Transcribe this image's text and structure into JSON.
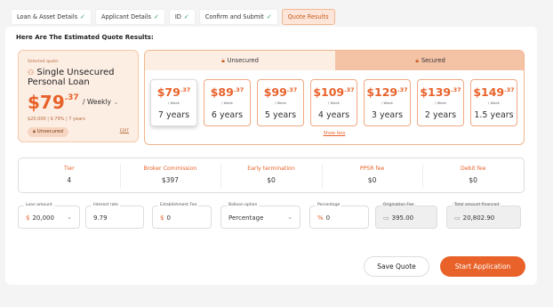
{
  "tabs": [
    {
      "label": "Loan & Asset Details",
      "done": "✓"
    },
    {
      "label": "Applicant Details",
      "done": "✓"
    },
    {
      "label": "ID",
      "done": "✓"
    },
    {
      "label": "Confirm and Submit",
      "done": "✓"
    },
    {
      "label": "Quote Results",
      "done": ""
    }
  ],
  "heading": "Here Are The Estimated Quote Results:",
  "selected": {
    "label": "Selected quote:",
    "name": "Single Unsecured Personal Loan",
    "price_whole": "$79",
    "price_cents": ".37",
    "frequency": "/ Weekly",
    "meta": "$20,000 | 9.79% | 7 years",
    "badge": "Unsecured",
    "edit": "EDIT"
  },
  "loan_tabs": {
    "unsecured": "Unsecured",
    "secured": "Secured"
  },
  "quotes": [
    {
      "whole": "$79",
      "cents": ".37",
      "per": "/ Week",
      "years": "7 years"
    },
    {
      "whole": "$89",
      "cents": ".37",
      "per": "/ Week",
      "years": "6 years"
    },
    {
      "whole": "$99",
      "cents": ".37",
      "per": "/ Week",
      "years": "5 years"
    },
    {
      "whole": "$109",
      "cents": ".37",
      "per": "/ Week",
      "years": "4 years"
    },
    {
      "whole": "$129",
      "cents": ".37",
      "per": "/ Week",
      "years": "3 years"
    },
    {
      "whole": "$139",
      "cents": ".37",
      "per": "/ Week",
      "years": "2 years"
    },
    {
      "whole": "$149",
      "cents": ".37",
      "per": "/ Week",
      "years": "1.5 years"
    }
  ],
  "show_less": "Show less",
  "stats": [
    {
      "label": "Tier",
      "value": "4"
    },
    {
      "label": "Broker Commission",
      "value": "$397"
    },
    {
      "label": "Early termination",
      "value": "$0"
    },
    {
      "label": "PPSR fee",
      "value": "$0"
    },
    {
      "label": "Debit fee",
      "value": "$0"
    }
  ],
  "fields": {
    "loan_amount": {
      "label": "Loan amount",
      "prefix": "$",
      "value": "20,000"
    },
    "interest_rate": {
      "label": "Interest rate",
      "value": "9.79"
    },
    "establishment_fee": {
      "label": "Establishment Fee",
      "prefix": "$",
      "value": "0"
    },
    "balloon_option": {
      "label": "Balloon option",
      "value": "Percentage"
    },
    "percentage": {
      "label": "Percentage",
      "prefix": "%",
      "value": "0"
    },
    "origination_fee": {
      "label": "Origination Fee",
      "value": "395.00"
    },
    "total_financed": {
      "label": "Total amount financed",
      "value": "20,802.90"
    }
  },
  "buttons": {
    "save": "Save Quote",
    "start": "Start Application"
  },
  "colors": {
    "accent": "#e8622a",
    "check": "#2e9e5b"
  }
}
